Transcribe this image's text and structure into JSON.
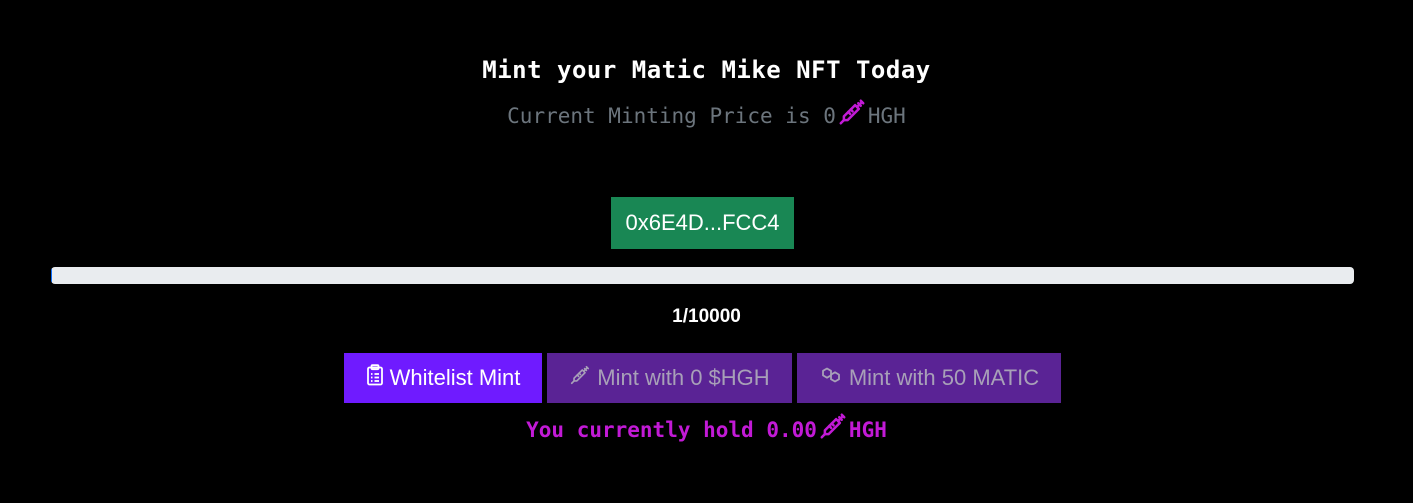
{
  "header": {
    "title": "Mint your Matic Mike NFT Today",
    "price_prefix": "Current Minting Price is 0",
    "price_icon": "syringe-icon",
    "price_suffix": "HGH"
  },
  "wallet": {
    "address_label": "0x6E4D...FCC4",
    "color": "#198754"
  },
  "progress": {
    "minted": 1,
    "total": 10000,
    "fraction": 0.0001,
    "label": "1/10000"
  },
  "actions": {
    "whitelist": {
      "label": "Whitelist Mint",
      "icon": "clipboard-icon",
      "color": "#6f1bff"
    },
    "hgh": {
      "label": "Mint with 0 $HGH",
      "icon": "syringe-icon",
      "color": "#5a2395"
    },
    "matic": {
      "label": "Mint with 50 MATIC",
      "icon": "chain-link-icon",
      "color": "#5a2395"
    }
  },
  "balance": {
    "prefix": "You currently hold 0.00",
    "icon": "syringe-icon",
    "suffix": "HGH",
    "color": "#c21ad6"
  },
  "colors": {
    "background": "#000000",
    "accent": "#c21ad6"
  }
}
